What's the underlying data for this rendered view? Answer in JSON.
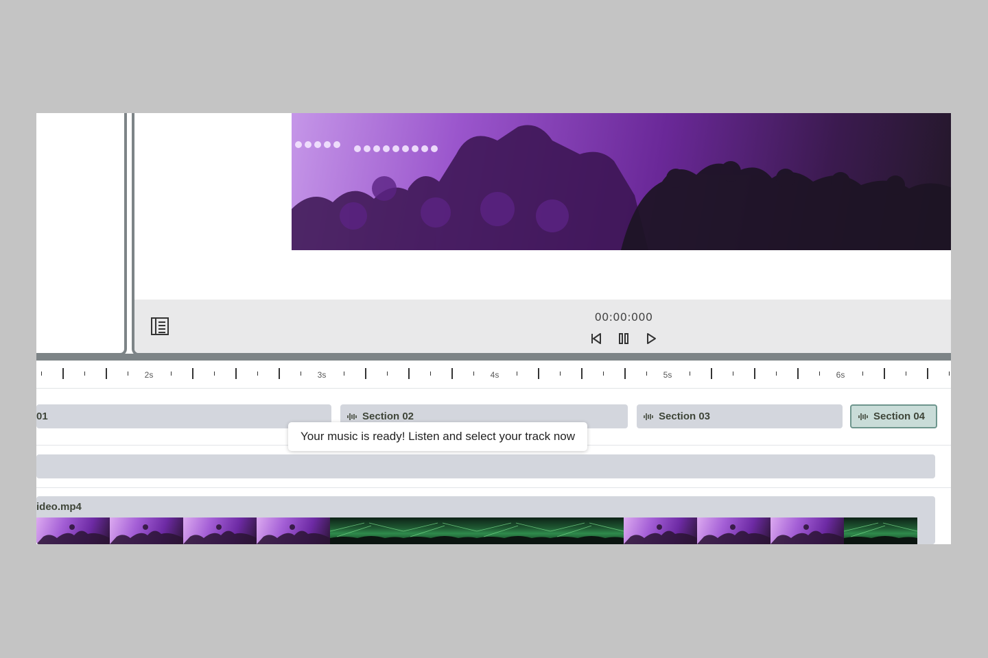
{
  "player": {
    "timecode": "00:00:000"
  },
  "controls": {
    "panel_toggle_icon": "panel-list-icon",
    "buttons": [
      {
        "name": "skip-back",
        "icon": "skip-back-icon"
      },
      {
        "name": "pause",
        "icon": "pause-icon"
      },
      {
        "name": "play",
        "icon": "play-icon"
      }
    ]
  },
  "timeline": {
    "ruler_labels": [
      "2s",
      "3s",
      "4s",
      "5s",
      "6s"
    ],
    "sections": [
      {
        "label": "01",
        "active": false
      },
      {
        "label": "Section 02",
        "active": false
      },
      {
        "label": "Section 03",
        "active": false
      },
      {
        "label": "Section 04",
        "active": true
      }
    ],
    "video_clip_name": "ideo.mp4",
    "thumbnails": [
      "purple",
      "purple",
      "purple",
      "purple",
      "green",
      "green",
      "green",
      "green",
      "purple",
      "purple",
      "purple",
      "green"
    ]
  },
  "tooltip": {
    "text": "Your music is ready! Listen and select your track now"
  },
  "colors": {
    "accent": "#6d958d",
    "chip": "#d3d6dd",
    "border_dark": "#7d8487"
  }
}
